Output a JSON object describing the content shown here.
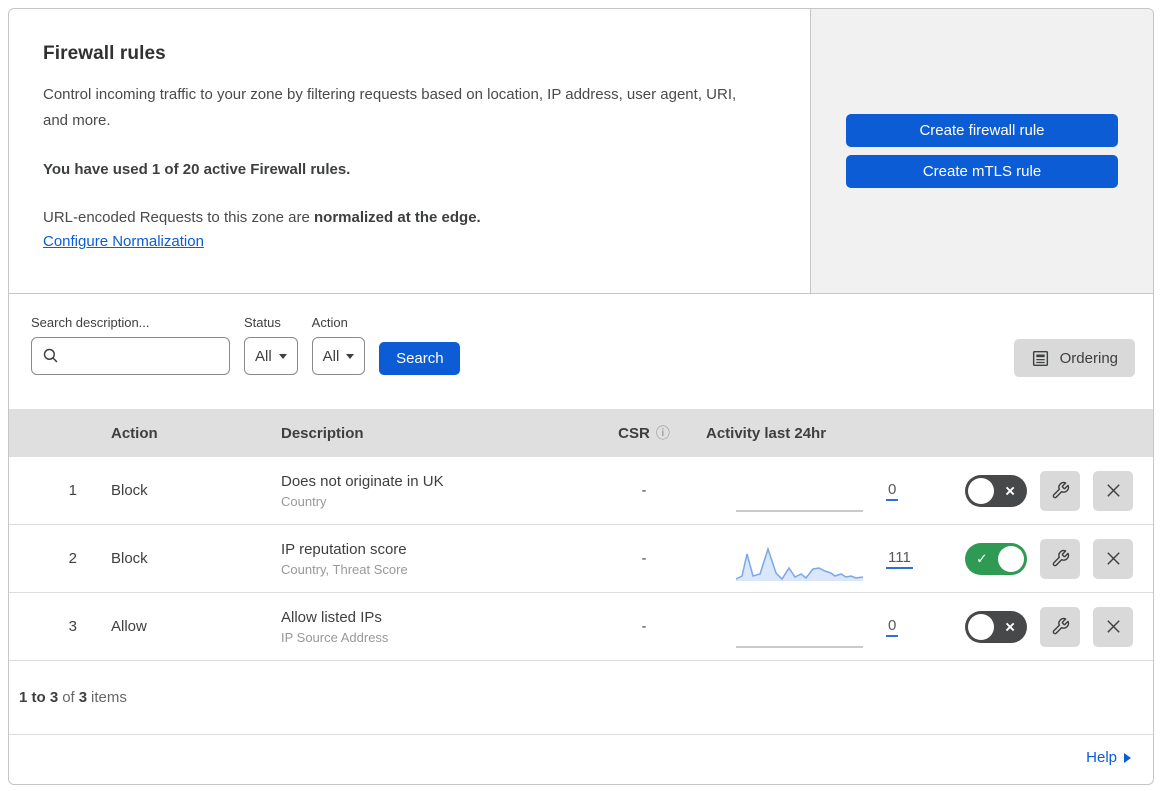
{
  "header": {
    "title": "Firewall rules",
    "description": "Control incoming traffic to your zone by filtering requests based on location, IP address, user agent, URI, and more.",
    "usage": "You have used 1 of 20 active Firewall rules.",
    "normalization_prefix": "URL-encoded Requests to this zone are ",
    "normalization_bold": "normalized at the edge.",
    "normalization_link": "Configure Normalization",
    "buttons": {
      "create_firewall": "Create firewall rule",
      "create_mtls": "Create mTLS rule"
    }
  },
  "filters": {
    "search_label": "Search description...",
    "search_value": "",
    "status_label": "Status",
    "status_value": "All",
    "action_label": "Action",
    "action_value": "All",
    "search_button": "Search",
    "ordering_button": "Ordering"
  },
  "table": {
    "headers": {
      "action": "Action",
      "description": "Description",
      "csr": "CSR",
      "activity": "Activity last 24hr"
    },
    "rows": [
      {
        "index": "1",
        "action": "Block",
        "description": "Does not originate in UK",
        "criteria": "Country",
        "csr": "-",
        "count": "0",
        "enabled": false,
        "sparkline": null
      },
      {
        "index": "2",
        "action": "Block",
        "description": "IP reputation score",
        "criteria": "Country, Threat Score",
        "csr": "-",
        "count": "111",
        "enabled": true,
        "sparkline": [
          [
            2,
            42
          ],
          [
            8,
            39
          ],
          [
            13,
            17
          ],
          [
            19,
            39
          ],
          [
            26,
            37
          ],
          [
            34,
            12
          ],
          [
            42,
            36
          ],
          [
            48,
            42
          ],
          [
            55,
            31
          ],
          [
            61,
            40
          ],
          [
            67,
            37
          ],
          [
            72,
            41
          ],
          [
            79,
            32
          ],
          [
            85,
            31
          ],
          [
            91,
            34
          ],
          [
            97,
            36
          ],
          [
            101,
            39
          ],
          [
            107,
            37
          ],
          [
            112,
            40
          ],
          [
            117,
            39
          ],
          [
            122,
            41
          ],
          [
            129,
            40
          ]
        ]
      },
      {
        "index": "3",
        "action": "Allow",
        "description": "Allow listed IPs",
        "criteria": "IP Source Address",
        "csr": "-",
        "count": "0",
        "enabled": false,
        "sparkline": null
      }
    ]
  },
  "footer": {
    "range": "1 to 3",
    "of": "of",
    "total": "3",
    "items_label": "items",
    "help_label": "Help"
  },
  "icons": {
    "toggle_check_glyph": "✓",
    "toggle_x_glyph": "×",
    "info_glyph": "ⓘ"
  },
  "colors": {
    "accent_blue": "#0b5cd5",
    "toggle_on_green": "#2f9a54",
    "toggle_off_gray": "#47484a",
    "sparkline_line": "#7aa7e9",
    "sparkline_fill": "rgba(122,167,233,0.28)",
    "flat_line": "#ababab",
    "panel_gray": "#f1f1f1",
    "header_gray": "#dfdfdf"
  }
}
